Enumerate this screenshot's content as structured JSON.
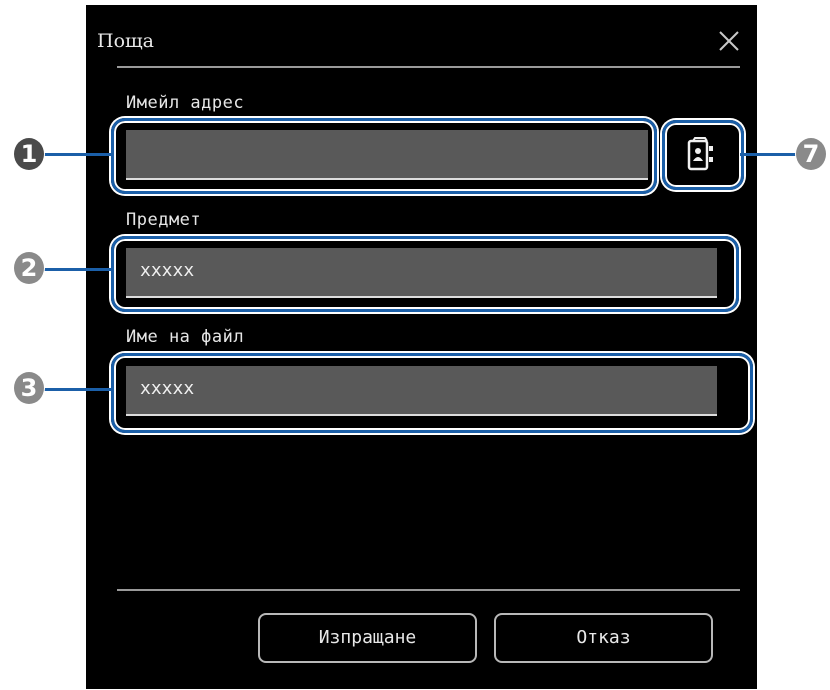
{
  "dialog": {
    "title": "Поща",
    "close_icon": "close-icon"
  },
  "fields": {
    "email": {
      "label": "Имейл адрес",
      "value": ""
    },
    "subject": {
      "label": "Предмет",
      "value": "xxxxx"
    },
    "filename": {
      "label": "Име на файл",
      "value": "xxxxx"
    }
  },
  "address_book_button": {
    "icon": "address-book-icon"
  },
  "buttons": {
    "send": "Изпращане",
    "cancel": "Отказ"
  },
  "callouts": {
    "c1": "1",
    "c2": "2",
    "c3": "3",
    "c7": "7"
  },
  "colors": {
    "dialog_bg": "#000000",
    "field_bg": "#595959",
    "highlight": "#1b5fa8",
    "callout": "#8a8a8a"
  }
}
